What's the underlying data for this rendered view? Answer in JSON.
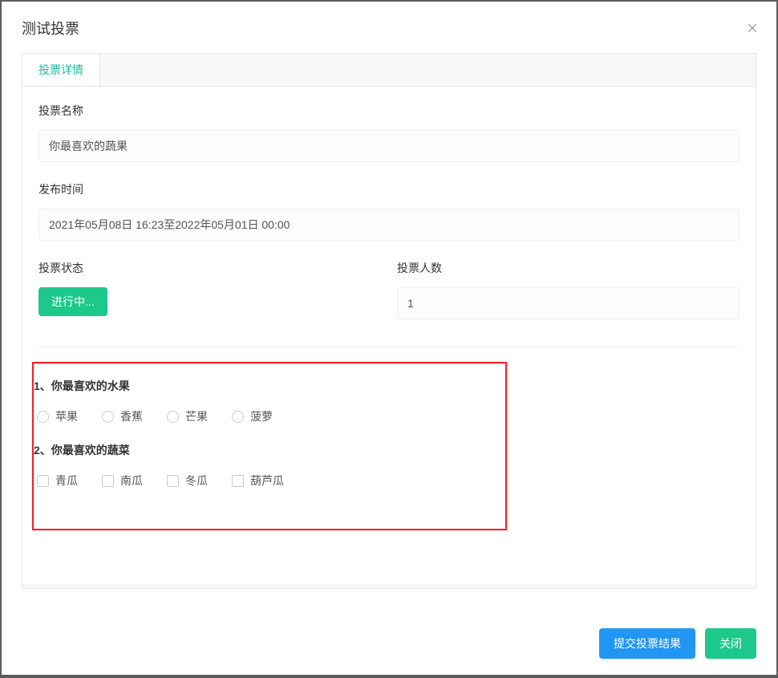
{
  "modal": {
    "title": "测试投票"
  },
  "tabs": [
    {
      "label": "投票详情"
    }
  ],
  "form": {
    "name_label": "投票名称",
    "name_value": "你最喜欢的蔬果",
    "publish_time_label": "发布时间",
    "publish_time_value": "2021年05月08日 16:23至2022年05月01日 00:00",
    "status_label": "投票状态",
    "status_value": "进行中...",
    "vote_count_label": "投票人数",
    "vote_count_value": "1"
  },
  "questions": [
    {
      "title": "1、你最喜欢的水果",
      "type": "radio",
      "options": [
        "苹果",
        "香蕉",
        "芒果",
        "菠萝"
      ]
    },
    {
      "title": "2、你最喜欢的蔬菜",
      "type": "checkbox",
      "options": [
        "青瓜",
        "南瓜",
        "冬瓜",
        "葫芦瓜"
      ]
    }
  ],
  "footer": {
    "submit_label": "提交投票结果",
    "close_label": "关闭"
  }
}
